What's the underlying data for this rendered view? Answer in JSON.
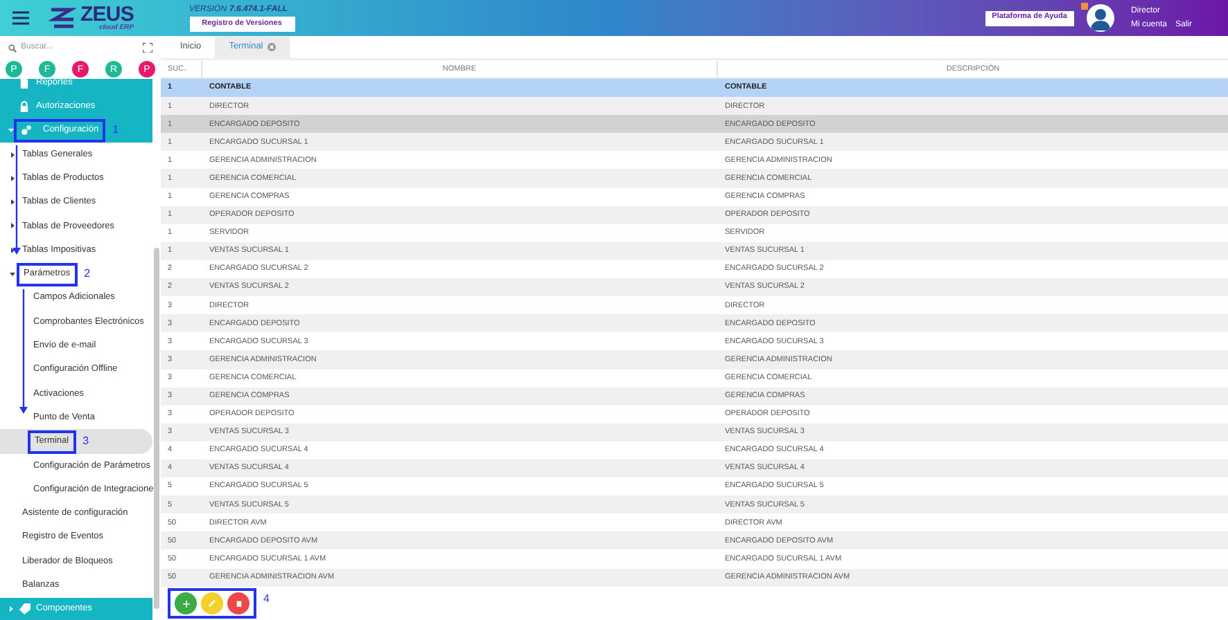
{
  "header": {
    "logo": {
      "name": "ZEUS",
      "tagline": "cloud ERP"
    },
    "version_label": "VERSIÓN",
    "version": "7.6.474.1-FALL",
    "versions_button": "Registro de Versiones",
    "help_button": "Plataforma de Ayuda",
    "user": {
      "name": "Director",
      "links": [
        "Mi cuenta",
        "Salir"
      ]
    }
  },
  "sidebar": {
    "search": {
      "placeholder": "Buscar..."
    },
    "shortcuts": [
      {
        "label": "P",
        "color": "#1fb89a"
      },
      {
        "label": "F",
        "color": "#1fb89a"
      },
      {
        "label": "F",
        "color": "#e8196b"
      },
      {
        "label": "R",
        "color": "#1fb89a"
      },
      {
        "label": "P",
        "color": "#e8196b"
      }
    ],
    "items": [
      {
        "label": "Reportes",
        "kind": "module"
      },
      {
        "label": "Autorizaciones",
        "kind": "module"
      },
      {
        "label": "Configuración",
        "kind": "module",
        "expanded": true,
        "annotation": "1",
        "children": [
          {
            "label": "Tablas Generales",
            "kind": "group",
            "expanded": false
          },
          {
            "label": "Tablas de Productos",
            "kind": "group",
            "expanded": false
          },
          {
            "label": "Tablas de Clientes",
            "kind": "group",
            "expanded": false
          },
          {
            "label": "Tablas de Proveedores",
            "kind": "group",
            "expanded": false
          },
          {
            "label": "Tablas Impositivas",
            "kind": "group",
            "expanded": false
          },
          {
            "label": "Parámetros",
            "kind": "group",
            "expanded": true,
            "annotation": "2",
            "children": [
              {
                "label": "Campos Adicionales",
                "kind": "leaf",
                "selected": false
              },
              {
                "label": "Comprobantes Electrónicos",
                "kind": "leaf",
                "selected": false
              },
              {
                "label": "Envío de e-mail",
                "kind": "leaf",
                "selected": false
              },
              {
                "label": "Configuración Offline",
                "kind": "leaf",
                "selected": false
              },
              {
                "label": "Activaciones",
                "kind": "leaf",
                "selected": false
              },
              {
                "label": "Punto de Venta",
                "kind": "leaf",
                "selected": false
              },
              {
                "label": "Terminal",
                "kind": "leaf",
                "selected": true,
                "annotation": "3"
              },
              {
                "label": "Configuración de Parámetros",
                "kind": "leaf",
                "selected": false
              },
              {
                "label": "Configuración de Integracione",
                "kind": "leaf",
                "selected": false
              }
            ]
          },
          {
            "label": "Asistente de configuración",
            "kind": "leaf",
            "selected": false
          },
          {
            "label": "Registro de Eventos",
            "kind": "leaf",
            "selected": false
          },
          {
            "label": "Liberador de Bloqueos",
            "kind": "leaf",
            "selected": false
          },
          {
            "label": "Balanzas",
            "kind": "leaf",
            "selected": false
          }
        ]
      },
      {
        "label": "Componentes",
        "kind": "module",
        "expanded": false
      }
    ]
  },
  "tabs": [
    {
      "label": "Inicio",
      "selected": false,
      "closable": false
    },
    {
      "label": "Terminal",
      "selected": true,
      "closable": true
    }
  ],
  "table": {
    "columns": [
      "SUC.",
      "NOMBRE",
      "DESCRIPCIÓN"
    ],
    "rows": [
      {
        "suc": "1",
        "nombre": "CONTABLE",
        "descripcion": "CONTABLE",
        "selected": true,
        "hovered": false
      },
      {
        "suc": "1",
        "nombre": "DIRECTOR",
        "descripcion": "DIRECTOR",
        "selected": false,
        "hovered": false
      },
      {
        "suc": "1",
        "nombre": "ENCARGADO DEPOSITO",
        "descripcion": "ENCARGADO DEPOSITO",
        "selected": false,
        "hovered": true
      },
      {
        "suc": "1",
        "nombre": "ENCARGADO SUCURSAL 1",
        "descripcion": "ENCARGADO SUCURSAL 1",
        "selected": false,
        "hovered": false
      },
      {
        "suc": "1",
        "nombre": "GERENCIA ADMINISTRACION",
        "descripcion": "GERENCIA ADMINISTRACION",
        "selected": false,
        "hovered": false
      },
      {
        "suc": "1",
        "nombre": "GERENCIA COMERCIAL",
        "descripcion": "GERENCIA COMERCIAL",
        "selected": false,
        "hovered": false
      },
      {
        "suc": "1",
        "nombre": "GERENCIA COMPRAS",
        "descripcion": "GERENCIA COMPRAS",
        "selected": false,
        "hovered": false
      },
      {
        "suc": "1",
        "nombre": "OPERADOR DEPOSITO",
        "descripcion": "OPERADOR DEPOSITO",
        "selected": false,
        "hovered": false
      },
      {
        "suc": "1",
        "nombre": "SERVIDOR",
        "descripcion": "SERVIDOR",
        "selected": false,
        "hovered": false
      },
      {
        "suc": "1",
        "nombre": "VENTAS SUCURSAL 1",
        "descripcion": "VENTAS SUCURSAL 1",
        "selected": false,
        "hovered": false
      },
      {
        "suc": "2",
        "nombre": "ENCARGADO SUCURSAL 2",
        "descripcion": "ENCARGADO SUCURSAL 2",
        "selected": false,
        "hovered": false
      },
      {
        "suc": "2",
        "nombre": "VENTAS SUCURSAL 2",
        "descripcion": "VENTAS SUCURSAL 2",
        "selected": false,
        "hovered": false
      },
      {
        "suc": "3",
        "nombre": "DIRECTOR",
        "descripcion": "DIRECTOR",
        "selected": false,
        "hovered": false
      },
      {
        "suc": "3",
        "nombre": "ENCARGADO DEPOSITO",
        "descripcion": "ENCARGADO DEPOSITO",
        "selected": false,
        "hovered": false
      },
      {
        "suc": "3",
        "nombre": "ENCARGADO SUCURSAL 3",
        "descripcion": "ENCARGADO SUCURSAL 3",
        "selected": false,
        "hovered": false
      },
      {
        "suc": "3",
        "nombre": "GERENCIA ADMINISTRACION",
        "descripcion": "GERENCIA ADMINISTRACION",
        "selected": false,
        "hovered": false
      },
      {
        "suc": "3",
        "nombre": "GERENCIA COMERCIAL",
        "descripcion": "GERENCIA COMERCIAL",
        "selected": false,
        "hovered": false
      },
      {
        "suc": "3",
        "nombre": "GERENCIA COMPRAS",
        "descripcion": "GERENCIA COMPRAS",
        "selected": false,
        "hovered": false
      },
      {
        "suc": "3",
        "nombre": "OPERADOR DEPOSITO",
        "descripcion": "OPERADOR DEPOSITO",
        "selected": false,
        "hovered": false
      },
      {
        "suc": "3",
        "nombre": "VENTAS SUCURSAL 3",
        "descripcion": "VENTAS SUCURSAL 3",
        "selected": false,
        "hovered": false
      },
      {
        "suc": "4",
        "nombre": "ENCARGADO SUCURSAL 4",
        "descripcion": "ENCARGADO SUCURSAL 4",
        "selected": false,
        "hovered": false
      },
      {
        "suc": "4",
        "nombre": "VENTAS SUCURSAL 4",
        "descripcion": "VENTAS SUCURSAL 4",
        "selected": false,
        "hovered": false
      },
      {
        "suc": "5",
        "nombre": "ENCARGADO SUCURSAL 5",
        "descripcion": "ENCARGADO SUCURSAL 5",
        "selected": false,
        "hovered": false
      },
      {
        "suc": "5",
        "nombre": "VENTAS SUCURSAL 5",
        "descripcion": "VENTAS SUCURSAL 5",
        "selected": false,
        "hovered": false
      },
      {
        "suc": "50",
        "nombre": "DIRECTOR AVM",
        "descripcion": "DIRECTOR AVM",
        "selected": false,
        "hovered": false
      },
      {
        "suc": "50",
        "nombre": "ENCARGADO DEPOSITO AVM",
        "descripcion": "ENCARGADO DEPOSITO AVM",
        "selected": false,
        "hovered": false
      },
      {
        "suc": "50",
        "nombre": "ENCARGADO SUCURSAL 1 AVM",
        "descripcion": "ENCARGADO SUCURSAL 1 AVM",
        "selected": false,
        "hovered": false
      },
      {
        "suc": "50",
        "nombre": "GERENCIA ADMINISTRACION AVM",
        "descripcion": "GERENCIA ADMINISTRACION AVM",
        "selected": false,
        "hovered": false
      }
    ]
  },
  "actions": {
    "annotation": "4",
    "buttons": [
      {
        "kind": "add"
      },
      {
        "kind": "edit"
      },
      {
        "kind": "delete"
      }
    ]
  }
}
